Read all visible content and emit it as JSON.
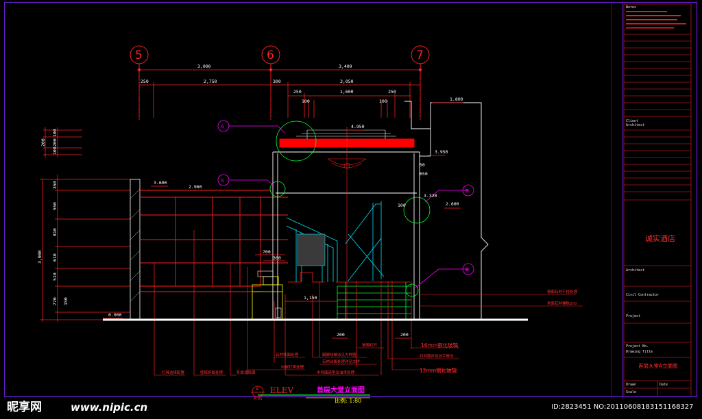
{
  "colors": {
    "frame": "#6a1bd1",
    "red": "#ff2020",
    "white": "#ffffff",
    "cyan": "#00e5ff",
    "green": "#00ff33",
    "magenta": "#ff00ff",
    "yellow": "#ffff00"
  },
  "grid_axes": [
    "5",
    "6",
    "7"
  ],
  "dims_top": {
    "d1": "3,000",
    "d2": "3,400",
    "d3": "250",
    "d4": "2,750",
    "d5": "300",
    "d6": "3,050",
    "d7": "250",
    "d8": "1,600",
    "d9": "250",
    "d10": "100",
    "d11": "100"
  },
  "dims_left": {
    "a": "200",
    "b": "100",
    "c": "200",
    "d": "100",
    "e": "350",
    "f": "550",
    "g": "810",
    "h": "610",
    "i": "510",
    "j": "770",
    "k": "150",
    "total": "3,000"
  },
  "levels": {
    "l1": "4.950",
    "l2": "3.950",
    "l3": "3.600",
    "l4": "2.960",
    "l5": "3.320",
    "l6": "2.600",
    "l7": "1.800",
    "l8": "0.000",
    "l9": "650"
  },
  "small_dims": {
    "s1": "700",
    "s2": "300",
    "s3": "1,150",
    "s4": "100",
    "s5": "200",
    "s6": "200",
    "s7": "50"
  },
  "tags": {
    "a": "A",
    "b": "A",
    "c": "B",
    "d": "B",
    "e": "A"
  },
  "notes": {
    "n1": "灯具选择配置",
    "n2": "壁纸饰面处理",
    "n3": "乳胶漆饰面",
    "n4": "石材饰面处理",
    "n5": "内嵌灯带处理",
    "n6": "踢脚线做法见大样图",
    "n7": "玻璃栏杆",
    "n8": "石材台面处理详见大样",
    "n9": "木饰面造型及油漆处理",
    "n10": "16mm钢化玻璃",
    "n11": "石材踏步及扶手做法",
    "n12": "12mm钢化玻璃",
    "n13": "墙面石材干挂处理",
    "n14": "地面石材铺贴200"
  },
  "title": {
    "elev": "ELEV",
    "tag_top": "A",
    "tag_bottom": "A-01",
    "name": "首层大堂立面图",
    "scale": "比例: 1:80"
  },
  "title_block": {
    "hotel": "诚实酒店",
    "drawing_name": "首层大堂A立面图",
    "labels": [
      "Notes",
      "Client",
      "Architect",
      "Civil Contractor",
      "Project",
      "Project No.",
      "Drawing Title",
      "Drawn",
      "Date",
      "Scale"
    ]
  },
  "watermark": {
    "logo": "昵享网",
    "url": "www.nipic.cn",
    "id": "ID:2823451 NO:20110608183151168327"
  }
}
